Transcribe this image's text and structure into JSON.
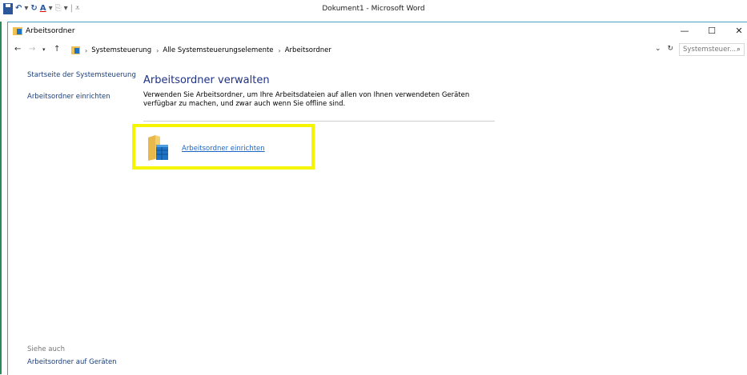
{
  "word": {
    "title": "Dokument1 - Microsoft Word",
    "accent_color": "#2b8a5a"
  },
  "window": {
    "title": "Arbeitsordner",
    "icon": "work-folders-icon",
    "controls": {
      "minimize": "—",
      "maximize": "☐",
      "close": "✕"
    }
  },
  "address": {
    "breadcrumbs": [
      "Systemsteuerung",
      "Alle Systemsteuerungselemente",
      "Arbeitsordner"
    ],
    "search_placeholder": "Systemsteuer..."
  },
  "sidebar": {
    "links": [
      "Startseite der Systemsteuerung",
      "Arbeitsordner einrichten"
    ],
    "see_also_label": "Siehe auch",
    "see_also_link": "Arbeitsordner auf Geräten"
  },
  "main": {
    "heading": "Arbeitsordner verwalten",
    "description": "Verwenden Sie Arbeitsordner, um Ihre Arbeitsdateien auf allen von Ihnen verwendeten Geräten verfügbar zu machen, und zwar auch wenn Sie offline sind.",
    "setup_link": "Arbeitsordner einrichten",
    "highlight_color": "#f5f500"
  }
}
